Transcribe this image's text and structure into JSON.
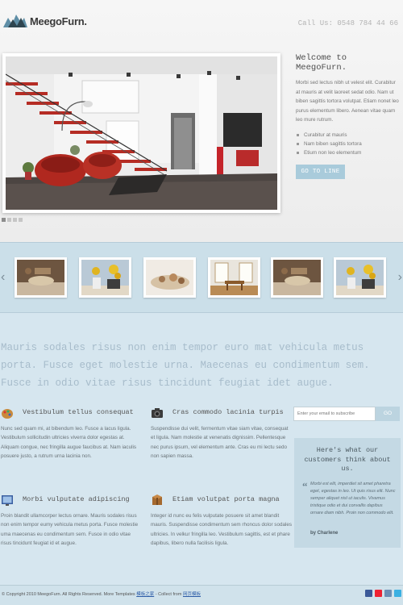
{
  "brand": {
    "name": "MeegoFurn."
  },
  "header": {
    "phone": "Call Us: 0548 784 44 66"
  },
  "welcome": {
    "title": "Welcome to MeegoFurn.",
    "body": "Morbi sed lectus nibh ut velest elit. Curabitur at mauris at velit laoreet sedat odio. Nam ut biben sagittis tortora volutpat. Etiam nonet leo purus elementum libero. Aenean vitae quam leo mure rutrum.",
    "list": [
      "Curabitur at mauris",
      "Nam biben sagittis tortora",
      "Etium non leo elementum"
    ],
    "button": "GO TO LINE"
  },
  "quote": "Mauris sodales risus non enim tempor euro mat vehicula metus porta. Fusce eget molestie urna. Maecenas eu condimentum sem. Fusce in odio vitae risus tincidunt feugiat idet augue.",
  "features": [
    {
      "icon": "palette-icon",
      "title": "Vestibulum tellus consequat",
      "text": "Nunc sed quam mi, at bibendum leo. Fusce a lacus ligula. Vestibulum sollicitudin ultricies viverra dolor egestas at. Aliquam congue, nec fringilla augue faucibus at. Nam iaculis posuere justo, a rutrum urna lacinia non."
    },
    {
      "icon": "camera-icon",
      "title": "Cras commodo lacinia turpis",
      "text": "Suspendisse dui velit, fermentum vitae siam vitae, consequat et ligula. Nam molestie at venenatis dignissim. Pellentesque nec purus ipsum, vel elementum ante. Cras eu mi lectu sedo non sapien massa."
    },
    {
      "icon": "monitor-icon",
      "title": "Morbi vulputate adipiscing",
      "text": "Proin blandit ullamcorper lectus ornare. Mauris sodales risus non enim tempor eumy vehicula metus porta. Fusce molestie uma maecenas eu condimentum sem. Fusce in odio vitae risus tincidunt feugiat id et augue."
    },
    {
      "icon": "box-icon",
      "title": "Etiam volutpat porta magna",
      "text": "Integer id nunc eu felis vulputate posuere sit amet blandit mauris. Suspendisse condimentum sem rhoncus dolor sodales ultricies. In velkur fringilla leo. Vestibulum sagittis, est et phare dapibus, libero nulla facilisis ligula."
    }
  ],
  "subscribe": {
    "placeholder": "Enter your email to subscribe",
    "button": "GO"
  },
  "testimonial": {
    "title": "Here's what our customers think about us.",
    "text": "Morbi est elit, imperdiet sit amet pharetra eget, egestas in leo. Ut quis risus elit. Nunc semper aliquet nisl ut iaculis. Vivamus tristique odio et dui convallis dapibus ornare diam nibh. Proin non commodo elit.",
    "author": "by Charlene"
  },
  "footer": {
    "copyright": "© Copyright 2010 MeegoFurn. All Rights Reserved. More Templates",
    "link1": "模板之家",
    "mid": "- Collect from",
    "link2": "网页模板"
  },
  "colors": {
    "accent": "#a9cbdb",
    "band": "#cbdfe9",
    "body_bg": "#d6e6ef"
  }
}
